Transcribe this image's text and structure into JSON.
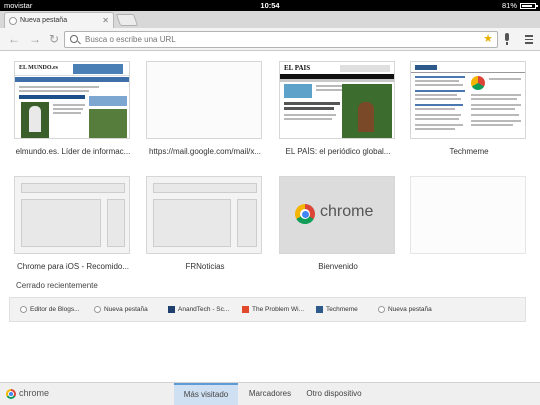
{
  "status_bar": {
    "carrier": "movistar",
    "time": "10:54",
    "battery_text": "81%",
    "battery_level": 0.81
  },
  "tab": {
    "title": "Nueva pestaña"
  },
  "omnibox": {
    "placeholder": "Busca o escribe una URL"
  },
  "most_visited": [
    {
      "label": "elmundo.es. Líder de informac...",
      "thumb_title": "EL MUNDO.es"
    },
    {
      "label": "https://mail.google.com/mail/x...",
      "thumb_title": ""
    },
    {
      "label": "EL PAÍS: el periódico global...",
      "thumb_title": "EL PAIS"
    },
    {
      "label": "Techmeme",
      "thumb_title": ""
    },
    {
      "label": "Chrome para iOS - Recomido...",
      "thumb_title": ""
    },
    {
      "label": "FRNoticias",
      "thumb_title": ""
    },
    {
      "label": "Bienvenido",
      "thumb_title": "chrome"
    },
    {
      "label": "",
      "thumb_title": ""
    }
  ],
  "recently_closed": {
    "title": "Cerrado recientemente",
    "items": [
      {
        "label": "Editor de Blogs..."
      },
      {
        "label": "Nueva pestaña"
      },
      {
        "label": "AnandTech - Sc..."
      },
      {
        "label": "The Problem Wi..."
      },
      {
        "label": "Techmeme"
      },
      {
        "label": "Nueva pestaña"
      }
    ]
  },
  "bottom_bar": {
    "brand": "chrome",
    "tabs": [
      {
        "label": "Más visitado",
        "active": true
      },
      {
        "label": "Marcadores",
        "active": false
      },
      {
        "label": "Otro dispositivo",
        "active": false
      }
    ]
  },
  "colors": {
    "active_tab_bg": "#cfe0f3",
    "active_tab_border": "#5e9ad6",
    "star": "#e8b100"
  }
}
